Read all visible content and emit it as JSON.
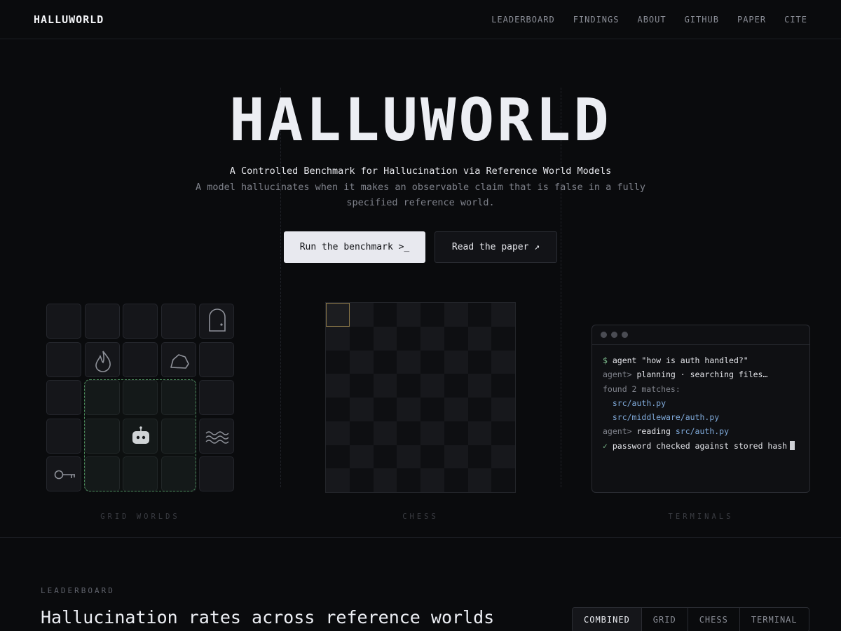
{
  "nav": {
    "brand": "HALLUWORLD",
    "links": [
      "LEADERBOARD",
      "FINDINGS",
      "ABOUT",
      "GITHUB",
      "PAPER",
      "CITE"
    ]
  },
  "hero": {
    "title": "HALLUWORLD",
    "subtitle": "A Controlled Benchmark for Hallucination via Reference World Models",
    "description": "A model hallucinates when it makes an observable claim that is false in a fully specified reference world.",
    "primary_button": "Run the benchmark >_",
    "secondary_button": "Read the paper ↗"
  },
  "panels": {
    "grid_caption": "GRID WORLDS",
    "chess_caption": "CHESS",
    "terminal_caption": "TERMINALS"
  },
  "grid_icons": [
    "door-icon",
    "fire-icon",
    "rock-icon",
    "robot-icon",
    "water-icon",
    "key-icon"
  ],
  "terminal": {
    "lines": [
      {
        "prefix": "$ ",
        "text": "agent \"how is auth handled?\""
      },
      {
        "prefix": "agent> ",
        "text": "planning · searching files…"
      },
      {
        "prefix": "",
        "text": "found 2 matches:"
      },
      {
        "prefix": "  ",
        "text": "src/auth.py"
      },
      {
        "prefix": "  ",
        "text": "src/middleware/auth.py"
      },
      {
        "prefix": "agent> ",
        "text": "reading ",
        "extra": "src/auth.py"
      },
      {
        "prefix": "✓ ",
        "text": "password checked against stored hash"
      }
    ]
  },
  "leaderboard": {
    "label": "LEADERBOARD",
    "title": "Hallucination rates across reference worlds",
    "tabs": [
      "COMBINED",
      "GRID",
      "CHESS",
      "TERMINAL"
    ],
    "active_tab": "COMBINED"
  },
  "colors": {
    "background": "#0a0b0d",
    "accent_green": "#7fc08f",
    "accent_blue": "#7fa9d9",
    "highlight_gold": "#8a7748"
  }
}
